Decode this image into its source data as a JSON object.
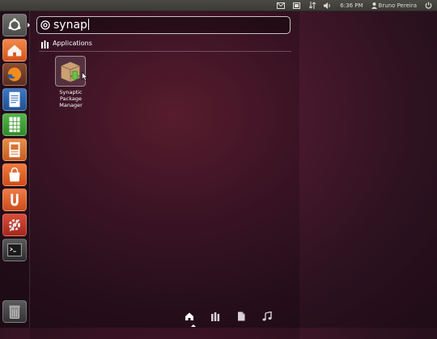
{
  "top_panel": {
    "clock": "6:36 PM",
    "user_name": "Bruno Pereira",
    "indicators": [
      "mail-icon",
      "battery-icon",
      "network-icon",
      "volume-icon",
      "clock",
      "user-icon",
      "power-icon"
    ]
  },
  "launcher": {
    "items": [
      {
        "name": "dash-home",
        "icon": "ubuntu-logo-icon",
        "color": "#5a5a58"
      },
      {
        "name": "home-folder",
        "icon": "home-folder-icon",
        "color": "#e8692c"
      },
      {
        "name": "firefox",
        "icon": "firefox-icon",
        "color": "#6b3b29"
      },
      {
        "name": "writer",
        "icon": "writer-icon",
        "color": "#2d5fa6"
      },
      {
        "name": "calc",
        "icon": "calc-icon",
        "color": "#3e9b35"
      },
      {
        "name": "impress",
        "icon": "impress-icon",
        "color": "#d9722f"
      },
      {
        "name": "software-center",
        "icon": "shopping-bag-icon",
        "color": "#e65f25"
      },
      {
        "name": "ubuntu-one",
        "icon": "ubuntu-one-icon",
        "color": "#e4602b"
      },
      {
        "name": "system-settings",
        "icon": "settings-icon",
        "color": "#c0392b"
      },
      {
        "name": "terminal",
        "icon": "terminal-icon",
        "color": "#3a3a3a"
      },
      {
        "name": "trash",
        "icon": "trash-icon",
        "color": "#444444"
      }
    ]
  },
  "dash": {
    "search_query": "synap",
    "category_label": "Applications",
    "results": [
      {
        "label": "Synaptic Package Manager",
        "icon": "package-box-icon"
      }
    ],
    "lenses": [
      "home-lens-icon",
      "applications-lens-icon",
      "files-lens-icon",
      "music-lens-icon"
    ],
    "active_lens": "home-lens-icon"
  },
  "colors": {
    "ubuntu_orange": "#e95420",
    "aubergine": "#2c001e",
    "panel": "#3c3b37"
  }
}
